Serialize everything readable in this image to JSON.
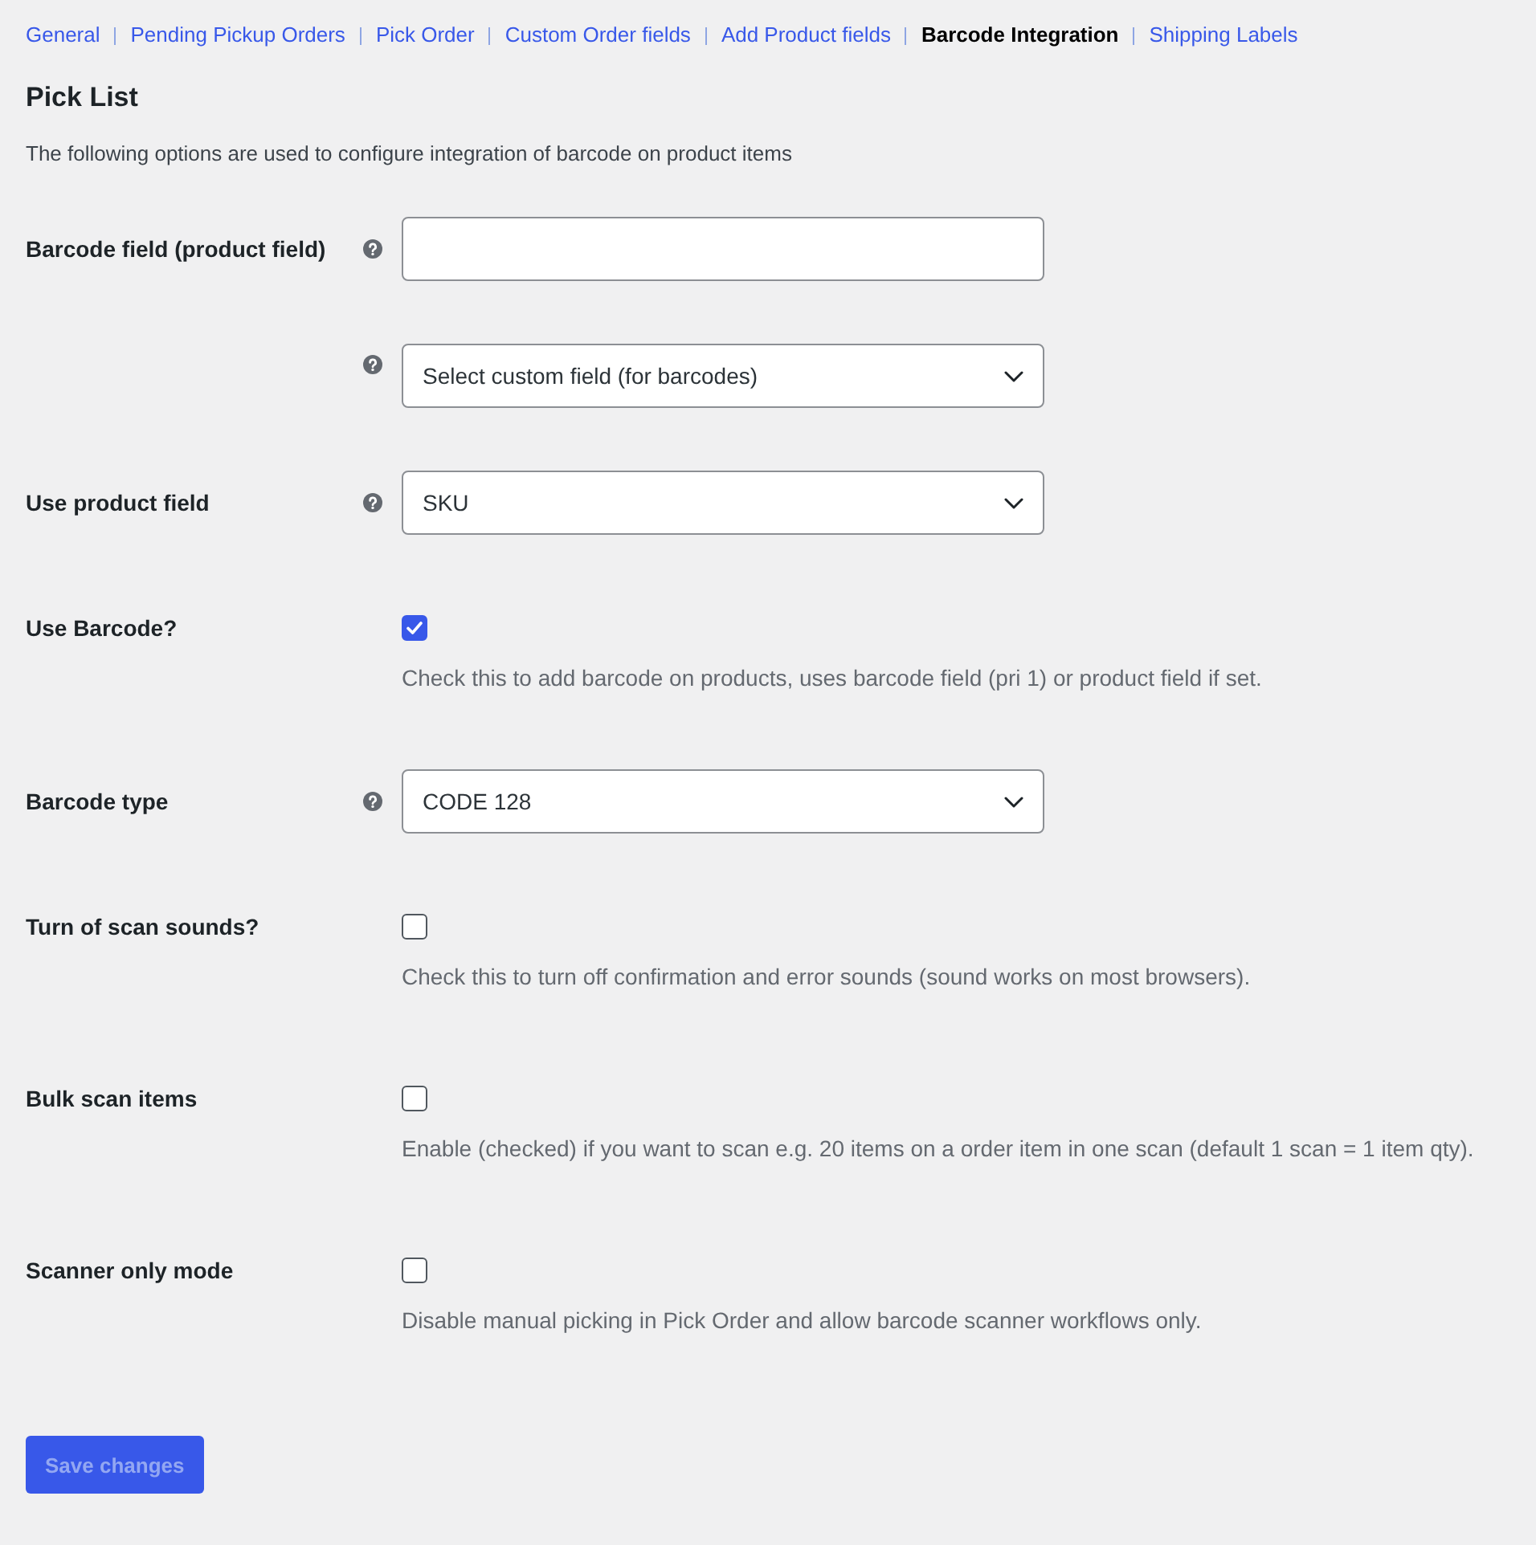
{
  "nav": [
    {
      "label": "General",
      "selected": false
    },
    {
      "label": "Pending Pickup Orders",
      "selected": false
    },
    {
      "label": "Pick Order",
      "selected": false
    },
    {
      "label": "Custom Order fields",
      "selected": false
    },
    {
      "label": "Add Product fields",
      "selected": false
    },
    {
      "label": "Barcode Integration",
      "selected": true
    },
    {
      "label": "Shipping Labels",
      "selected": false
    }
  ],
  "heading": "Pick List",
  "intro": "The following options are used to configure integration of barcode on product items",
  "settings": [
    {
      "kind": "text",
      "label": "Barcode field (product field)",
      "help": true
    },
    {
      "kind": "select",
      "help": true,
      "value": "Select custom field (for barcodes)"
    },
    {
      "kind": "select",
      "label": "Use product field",
      "help": true,
      "value": "SKU"
    },
    {
      "kind": "checkbox",
      "label": "Use Barcode?",
      "help": false,
      "checked": true,
      "description": "Check this to add barcode on products, uses barcode field (pri 1) or product field if set."
    },
    {
      "kind": "select",
      "label": "Barcode type",
      "help": true,
      "value": "CODE 128"
    },
    {
      "kind": "checkbox",
      "label": "Turn of scan sounds?",
      "help": false,
      "checked": false,
      "description": "Check this to turn off confirmation and error sounds (sound works on most browsers)."
    },
    {
      "kind": "checkbox",
      "label": "Bulk scan items",
      "help": false,
      "checked": false,
      "description": "Enable (checked) if you want to scan e.g. 20 items on a order item in one scan (default 1 scan = 1 item qty)."
    },
    {
      "kind": "checkbox",
      "label": "Scanner only mode",
      "help": false,
      "checked": false,
      "description": "Disable manual picking in Pick Order and allow barcode scanner workflows only."
    }
  ],
  "save_button": {
    "label": "Save changes",
    "disabled": true
  }
}
